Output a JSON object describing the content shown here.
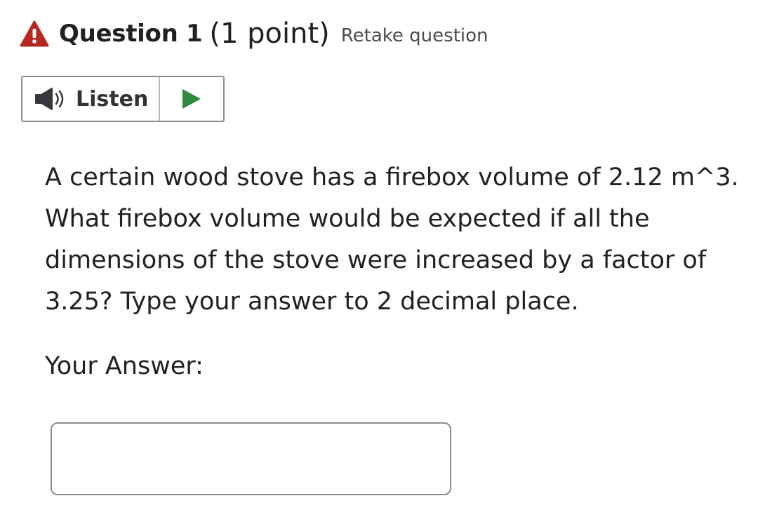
{
  "question": {
    "title": "Question 1",
    "points": "(1 point)",
    "retake_label": "Retake question",
    "warning_color": "#b5271f",
    "body": "A certain wood stove has a firebox volume of 2.12 m^3. What firebox volume would be expected if all the dimensions of the stove were increased by a factor of 3.25? Type your answer to 2 decimal place."
  },
  "listen": {
    "label": "Listen",
    "speaker_icon": "speaker-icon",
    "play_icon": "play-icon",
    "play_color": "#2e8b3e"
  },
  "answer": {
    "label": "Your Answer:",
    "value": "",
    "placeholder": ""
  }
}
